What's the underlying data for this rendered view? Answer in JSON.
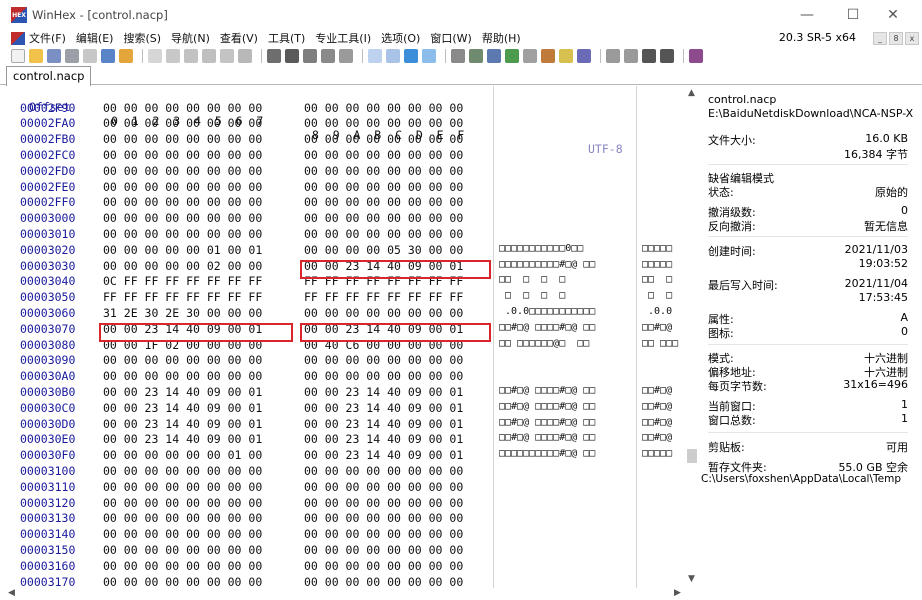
{
  "window": {
    "title": "WinHex - [control.nacp]",
    "logo_text": "HEX",
    "minimize": "—",
    "maximize": "☐",
    "close": "✕"
  },
  "menu": {
    "items": [
      "文件(F)",
      "编辑(E)",
      "搜索(S)",
      "导航(N)",
      "查看(V)",
      "工具(T)",
      "专业工具(I)",
      "选项(O)",
      "窗口(W)",
      "帮助(H)"
    ],
    "version": "20.3 SR-5 x64",
    "mini_buttons": [
      "_",
      "8",
      "x"
    ]
  },
  "tab": {
    "label": "control.nacp"
  },
  "hex": {
    "header": {
      "offset": "Offset",
      "cols_a": "0  1  2  3  4  5  6  7",
      "cols_b": "8  9  A  B  C  D  E  F",
      "encoding": "UTF-8"
    },
    "rows": [
      {
        "offset": "00002F90",
        "a": "00 00 00 00 00 00 00 00",
        "b": "00 00 00 00 00 00 00 00",
        "t": "",
        "t2": ""
      },
      {
        "offset": "00002FA0",
        "a": "00 00 00 00 00 00 00 00",
        "b": "00 00 00 00 00 00 00 00",
        "t": "",
        "t2": ""
      },
      {
        "offset": "00002FB0",
        "a": "00 00 00 00 00 00 00 00",
        "b": "00 00 00 00 00 00 00 00",
        "t": "",
        "t2": ""
      },
      {
        "offset": "00002FC0",
        "a": "00 00 00 00 00 00 00 00",
        "b": "00 00 00 00 00 00 00 00",
        "t": "",
        "t2": ""
      },
      {
        "offset": "00002FD0",
        "a": "00 00 00 00 00 00 00 00",
        "b": "00 00 00 00 00 00 00 00",
        "t": "",
        "t2": ""
      },
      {
        "offset": "00002FE0",
        "a": "00 00 00 00 00 00 00 00",
        "b": "00 00 00 00 00 00 00 00",
        "t": "",
        "t2": ""
      },
      {
        "offset": "00002FF0",
        "a": "00 00 00 00 00 00 00 00",
        "b": "00 00 00 00 00 00 00 00",
        "t": "",
        "t2": ""
      },
      {
        "offset": "00003000",
        "a": "00 00 00 00 00 00 00 00",
        "b": "00 00 00 00 00 00 00 00",
        "t": "",
        "t2": ""
      },
      {
        "offset": "00003010",
        "a": "00 00 00 00 00 00 00 00",
        "b": "00 00 00 00 00 00 00 00",
        "t": "",
        "t2": ""
      },
      {
        "offset": "00003020",
        "a": "00 00 00 00 00 01 00 01",
        "b": "00 00 00 00 05 30 00 00",
        "t": "□□□□□□□□□□□0□□",
        "t2": "□□□□□"
      },
      {
        "offset": "00003030",
        "a": "00 00 00 00 00 02 00 00",
        "b": "00 00 23 14 40 09 00 01",
        "t": "□□□□□□□□□□#□@ □□",
        "t2": "□□□□□"
      },
      {
        "offset": "00003040",
        "a": "0C FF FF FF FF FF FF FF",
        "b": "FF FF FF FF FF FF FF FF",
        "t": "□□  □  □  □",
        "t2": "□□  □"
      },
      {
        "offset": "00003050",
        "a": "FF FF FF FF FF FF FF FF",
        "b": "FF FF FF FF FF FF FF FF",
        "t": " □  □  □  □",
        "t2": " □  □"
      },
      {
        "offset": "00003060",
        "a": "31 2E 30 2E 30 00 00 00",
        "b": "00 00 00 00 00 00 00 00",
        "t": " .0.0□□□□□□□□□□□",
        "t2": " .0.0"
      },
      {
        "offset": "00003070",
        "a": "00 00 23 14 40 09 00 01",
        "b": "00 00 23 14 40 09 00 01",
        "t": "□□#□@ □□□□#□@ □□",
        "t2": "□□#□@"
      },
      {
        "offset": "00003080",
        "a": "00 00 1F 02 00 00 00 00",
        "b": "00 40 C6 00 00 00 00 00",
        "t": "□□ □□□□□□@□  □□",
        "t2": "□□ □□□"
      },
      {
        "offset": "00003090",
        "a": "00 00 00 00 00 00 00 00",
        "b": "00 00 00 00 00 00 00 00",
        "t": "",
        "t2": ""
      },
      {
        "offset": "000030A0",
        "a": "00 00 00 00 00 00 00 00",
        "b": "00 00 00 00 00 00 00 00",
        "t": "",
        "t2": ""
      },
      {
        "offset": "000030B0",
        "a": "00 00 23 14 40 09 00 01",
        "b": "00 00 23 14 40 09 00 01",
        "t": "□□#□@ □□□□#□@ □□",
        "t2": "□□#□@"
      },
      {
        "offset": "000030C0",
        "a": "00 00 23 14 40 09 00 01",
        "b": "00 00 23 14 40 09 00 01",
        "t": "□□#□@ □□□□#□@ □□",
        "t2": "□□#□@"
      },
      {
        "offset": "000030D0",
        "a": "00 00 23 14 40 09 00 01",
        "b": "00 00 23 14 40 09 00 01",
        "t": "□□#□@ □□□□#□@ □□",
        "t2": "□□#□@"
      },
      {
        "offset": "000030E0",
        "a": "00 00 23 14 40 09 00 01",
        "b": "00 00 23 14 40 09 00 01",
        "t": "□□#□@ □□□□#□@ □□",
        "t2": "□□#□@"
      },
      {
        "offset": "000030F0",
        "a": "00 00 00 00 00 00 01 00",
        "b": "00 00 23 14 40 09 00 01",
        "t": "□□□□□□□□□□#□@ □□",
        "t2": "□□□□□"
      },
      {
        "offset": "00003100",
        "a": "00 00 00 00 00 00 00 00",
        "b": "00 00 00 00 00 00 00 00",
        "t": "",
        "t2": ""
      },
      {
        "offset": "00003110",
        "a": "00 00 00 00 00 00 00 00",
        "b": "00 00 00 00 00 00 00 00",
        "t": "",
        "t2": ""
      },
      {
        "offset": "00003120",
        "a": "00 00 00 00 00 00 00 00",
        "b": "00 00 00 00 00 00 00 00",
        "t": "",
        "t2": ""
      },
      {
        "offset": "00003130",
        "a": "00 00 00 00 00 00 00 00",
        "b": "00 00 00 00 00 00 00 00",
        "t": "",
        "t2": ""
      },
      {
        "offset": "00003140",
        "a": "00 00 00 00 00 00 00 00",
        "b": "00 00 00 00 00 00 00 00",
        "t": "",
        "t2": ""
      },
      {
        "offset": "00003150",
        "a": "00 00 00 00 00 00 00 00",
        "b": "00 00 00 00 00 00 00 00",
        "t": "",
        "t2": ""
      },
      {
        "offset": "00003160",
        "a": "00 00 00 00 00 00 00 00",
        "b": "00 00 00 00 00 00 00 00",
        "t": "",
        "t2": ""
      },
      {
        "offset": "00003170",
        "a": "00 00 00 00 00 00 00 00",
        "b": "00 00 00 00 00 00 00 00",
        "t": "",
        "t2": ""
      }
    ]
  },
  "panel": {
    "filename": "control.nacp",
    "path": "E:\\BaiduNetdiskDownload\\NCA-NSP-X",
    "file_size_label": "文件大小:",
    "file_size_kb": "16.0 KB",
    "file_size_bytes": "16,384 字节",
    "default_edit_mode": "缺省编辑模式",
    "state_label": "状态:",
    "state_value": "原始的",
    "undo_level_label": "撤消级数:",
    "undo_level_value": "0",
    "reverse_undo_label": "反向撤消:",
    "reverse_undo_value": "暂无信息",
    "created_label": "创建时间:",
    "created_date": "2021/11/03",
    "created_time": "19:03:52",
    "modified_label": "最后写入时间:",
    "modified_date": "2021/11/04",
    "modified_time": "17:53:45",
    "attr_label": "属性:",
    "attr_value": "A",
    "icon_label": "图标:",
    "icon_value": "0",
    "mode_label": "模式:",
    "mode_value": "十六进制",
    "offset_label": "偏移地址:",
    "offset_value": "十六进制",
    "bytes_per_page_label": "每页字节数:",
    "bytes_per_page_value": "31x16=496",
    "current_window_label": "当前窗口:",
    "current_window_value": "1",
    "total_windows_label": "窗口总数:",
    "total_windows_value": "1",
    "clipboard_label": "剪贴板:",
    "clipboard_value": "可用",
    "temp_folder_label": "暂存文件夹:",
    "temp_folder_value": "55.0 GB 空余",
    "temp_path": "C:\\Users\\foxshen\\AppData\\Local\\Temp"
  },
  "colors": {
    "offset_blue": "#1a1a9c",
    "highlight_red": "#d9262c"
  }
}
